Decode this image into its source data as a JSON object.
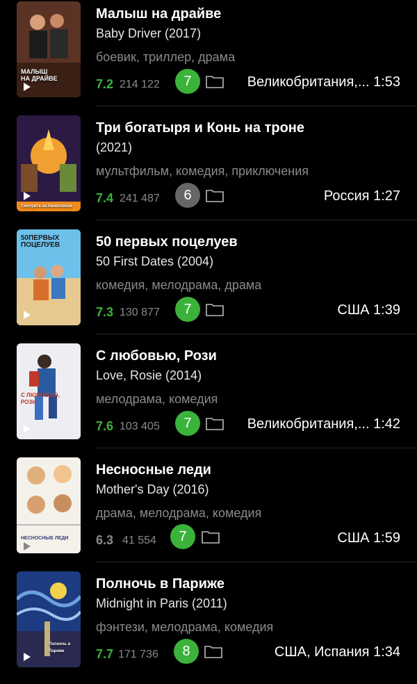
{
  "accent_green": "#3bb33b",
  "badge_gray": "#666666",
  "movies": [
    {
      "title": "Малыш на драйве",
      "orig": "Baby Driver (2017)",
      "genres": "боевик, триллер, драма",
      "rating": "7.2",
      "votes": "214 122",
      "my_rating": "7",
      "badge_color": "#3bb33b",
      "country_time": "Великобритания,... 1:53",
      "poster_caption": "МАЛЫШ\nНА ДРАЙВЕ",
      "poster_bg": "#4a2a20"
    },
    {
      "title": "Три богатыря и Конь на троне",
      "orig": "(2021)",
      "genres": "мультфильм, комедия, приключения",
      "rating": "7.4",
      "votes": "241 487",
      "my_rating": "6",
      "badge_color": "#666666",
      "country_time": "Россия 1:27",
      "poster_caption": "Смотрите на Кинопоиске",
      "poster_bg": "#3b1a4e"
    },
    {
      "title": "50 первых поцелуев",
      "orig": "50 First Dates (2004)",
      "genres": "комедия, мелодрама, драма",
      "rating": "7.3",
      "votes": "130 877",
      "my_rating": "7",
      "badge_color": "#3bb33b",
      "country_time": "США 1:39",
      "poster_caption": "50ПЕРВЫХ\nПОЦЕЛУЕВ",
      "poster_bg": "#4fa6d6"
    },
    {
      "title": "С любовью, Рози",
      "orig": "Love, Rosie (2014)",
      "genres": "мелодрама, комедия",
      "rating": "7.6",
      "votes": "103 405",
      "my_rating": "7",
      "badge_color": "#3bb33b",
      "country_time": "Великобритания,... 1:42",
      "poster_caption": "С ЛЮБОВЬЮ,\nРОЗИ",
      "poster_bg": "#e9e9ee"
    },
    {
      "title": "Несносные леди",
      "orig": "Mother's Day (2016)",
      "genres": "драма, мелодрама, комедия",
      "rating": "6.3",
      "votes": "41 554",
      "my_rating": "7",
      "badge_color": "#3bb33b",
      "country_time": "США 1:59",
      "poster_caption": "НЕСНОСНЫЕ ЛЕДИ",
      "poster_bg": "#f2efe8"
    },
    {
      "title": "Полночь в Париже",
      "orig": "Midnight in Paris (2011)",
      "genres": "фэнтези, мелодрама, комедия",
      "rating": "7.7",
      "votes": "171 736",
      "my_rating": "8",
      "badge_color": "#3bb33b",
      "country_time": "США, Испания 1:34",
      "poster_caption": "Полночь в Париже",
      "poster_bg": "#1b3b7a"
    }
  ]
}
